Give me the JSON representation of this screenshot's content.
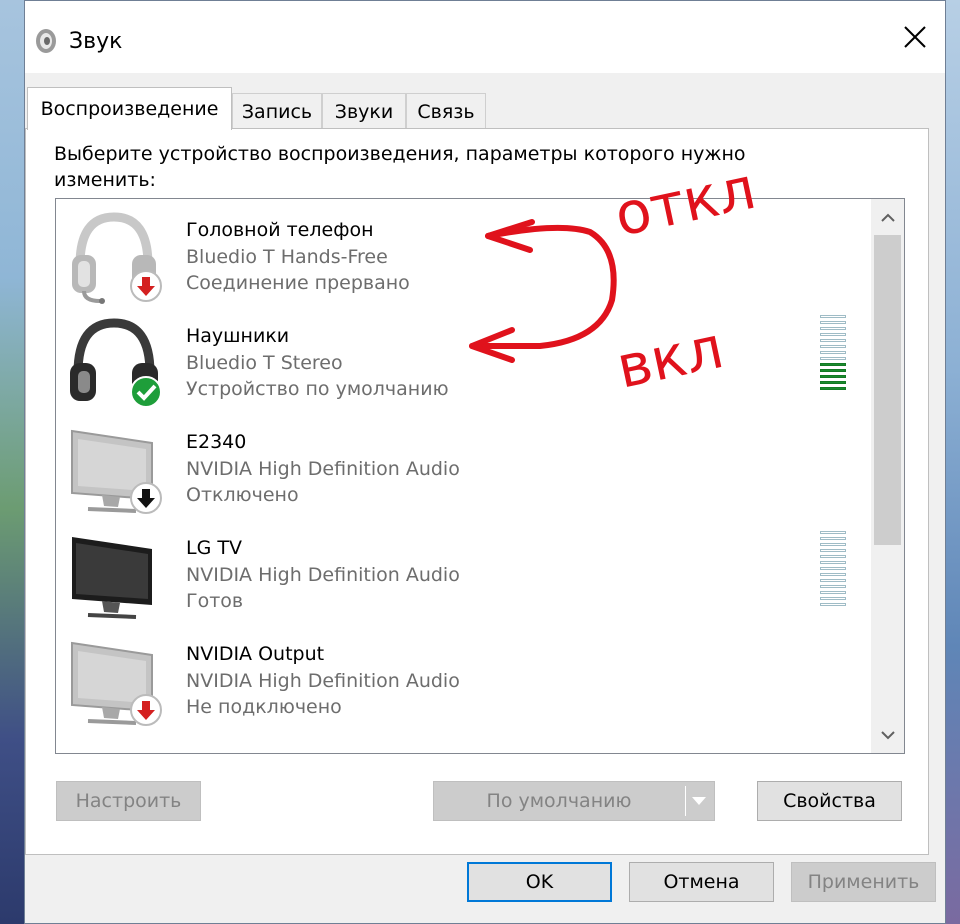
{
  "window": {
    "title": "Звук"
  },
  "tabs": [
    {
      "label": "Воспроизведение",
      "active": true
    },
    {
      "label": "Запись",
      "active": false
    },
    {
      "label": "Звуки",
      "active": false
    },
    {
      "label": "Связь",
      "active": false
    }
  ],
  "instruction": "Выберите устройство воспроизведения, параметры которого нужно изменить:",
  "devices": [
    {
      "name": "Головной телефон",
      "driver": "Bluedio T Hands-Free",
      "status": "Соединение прервано",
      "icon": "headset-icon",
      "badge": "red-down-arrow"
    },
    {
      "name": "Наушники",
      "driver": "Bluedio T Stereo",
      "status": "Устройство по умолчанию",
      "icon": "headphones-icon",
      "badge": "green-check",
      "level_active_fraction": 0.4
    },
    {
      "name": "E2340",
      "driver": "NVIDIA High Definition Audio",
      "status": "Отключено",
      "icon": "monitor-icon",
      "badge": "black-down-arrow"
    },
    {
      "name": "LG TV",
      "driver": "NVIDIA High Definition Audio",
      "status": "Готов",
      "icon": "tv-icon",
      "level_active_fraction": 0.0
    },
    {
      "name": "NVIDIA Output",
      "driver": "NVIDIA High Definition Audio",
      "status": "Не подключено",
      "icon": "monitor-icon",
      "badge": "red-down-arrow"
    }
  ],
  "buttons": {
    "configure": "Настроить",
    "set_default": "По умолчанию",
    "properties": "Свойства",
    "ok": "OK",
    "cancel": "Отмена",
    "apply": "Применить"
  },
  "annotation": {
    "top_word": "откл",
    "bottom_word": "вкл",
    "color": "#e0121c"
  },
  "colors": {
    "accent": "#0078d7",
    "level_on": "#1a8a2e",
    "error_badge": "#d42020",
    "ok_badge": "#1e9e3a"
  }
}
